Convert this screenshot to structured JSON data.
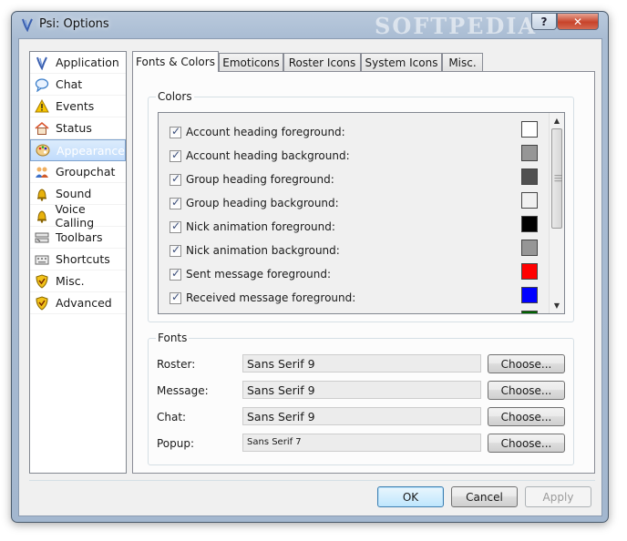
{
  "window": {
    "title": "Psi: Options",
    "watermark": "SOFTPEDIA",
    "help_label": "?",
    "close_label": "✕"
  },
  "sidebar": {
    "items": [
      {
        "label": "Application",
        "icon": "psi-app-icon",
        "color": "#3a5fb0"
      },
      {
        "label": "Chat",
        "icon": "speech-bubble-icon",
        "color": "#3a7dc9"
      },
      {
        "label": "Events",
        "icon": "warning-icon",
        "color": "#f0b400"
      },
      {
        "label": "Status",
        "icon": "home-icon",
        "color": "#d9532c"
      },
      {
        "label": "Appearance",
        "icon": "palette-icon",
        "color": "#e0a030"
      },
      {
        "label": "Groupchat",
        "icon": "group-icon",
        "color": "#d07020"
      },
      {
        "label": "Sound",
        "icon": "bell-icon",
        "color": "#d9a000"
      },
      {
        "label": "Voice Calling",
        "icon": "bell-icon",
        "color": "#d9a000"
      },
      {
        "label": "Toolbars",
        "icon": "toolbar-icon",
        "color": "#6a6a6a"
      },
      {
        "label": "Shortcuts",
        "icon": "keyboard-icon",
        "color": "#6a6a6a"
      },
      {
        "label": "Misc.",
        "icon": "shield-icon",
        "color": "#e0b000"
      },
      {
        "label": "Advanced",
        "icon": "shield-icon",
        "color": "#e0b000"
      }
    ],
    "selected_index": 4
  },
  "tabs": [
    {
      "label": "Fonts & Colors",
      "active": true
    },
    {
      "label": "Emoticons",
      "active": false
    },
    {
      "label": "Roster Icons",
      "active": false
    },
    {
      "label": "System Icons",
      "active": false
    },
    {
      "label": "Misc.",
      "active": false
    }
  ],
  "colors": {
    "title": "Colors",
    "rows": [
      {
        "label": "Account heading foreground:",
        "checked": true,
        "color": "#ffffff"
      },
      {
        "label": "Account heading background:",
        "checked": true,
        "color": "#969696"
      },
      {
        "label": "Group heading foreground:",
        "checked": true,
        "color": "#505050"
      },
      {
        "label": "Group heading background:",
        "checked": true,
        "color": "#f0f0f0"
      },
      {
        "label": "Nick animation foreground:",
        "checked": true,
        "color": "#000000"
      },
      {
        "label": "Nick animation background:",
        "checked": true,
        "color": "#969696"
      },
      {
        "label": "Sent message foreground:",
        "checked": true,
        "color": "#ff0000"
      },
      {
        "label": "Received message foreground:",
        "checked": true,
        "color": "#0000ff"
      }
    ],
    "partial_row_color": "#006400"
  },
  "fonts": {
    "title": "Fonts",
    "rows": [
      {
        "label": "Roster:",
        "value": "Sans Serif 9",
        "button": "Choose..."
      },
      {
        "label": "Message:",
        "value": "Sans Serif 9",
        "button": "Choose..."
      },
      {
        "label": "Chat:",
        "value": "Sans Serif 9",
        "button": "Choose..."
      },
      {
        "label": "Popup:",
        "value": "Sans Serif 7",
        "button": "Choose..."
      }
    ]
  },
  "buttons": {
    "ok": "OK",
    "cancel": "Cancel",
    "apply": "Apply"
  }
}
